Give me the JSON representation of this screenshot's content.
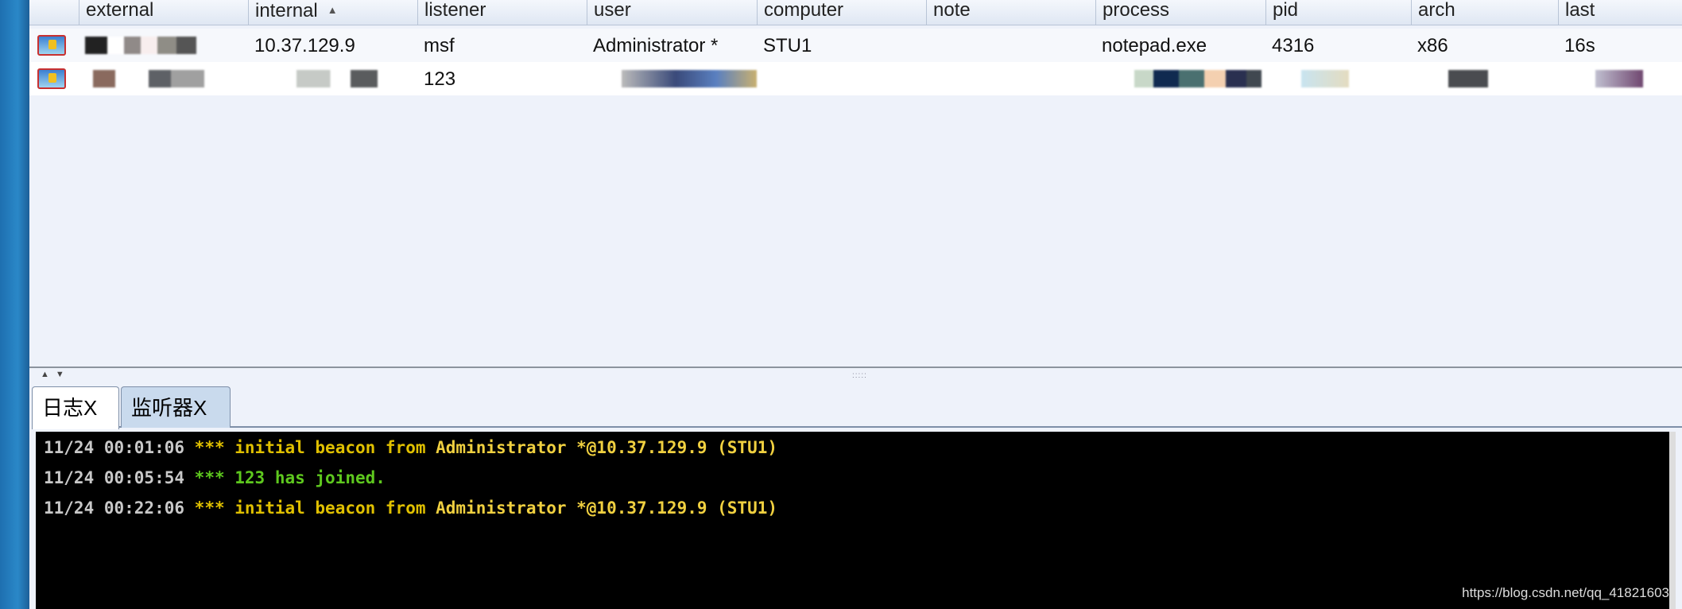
{
  "table": {
    "columns": [
      "external",
      "internal",
      "listener",
      "user",
      "computer",
      "note",
      "process",
      "pid",
      "arch",
      "last"
    ],
    "sorted_column": "internal",
    "rows": [
      {
        "external": "",
        "internal": "10.37.129.9",
        "listener": "msf",
        "user": "Administrator *",
        "computer": "STU1",
        "note": "",
        "process": "notepad.exe",
        "pid": "4316",
        "arch": "x86",
        "last": "16s",
        "icon": "windows-beacon-icon"
      },
      {
        "external": "",
        "internal": "",
        "listener": "123",
        "user": "",
        "computer": "",
        "note": "",
        "process": "",
        "pid": "",
        "arch": "",
        "last": "",
        "icon": "windows-beacon-icon"
      }
    ]
  },
  "tabs": [
    {
      "label": "日志X",
      "active": true
    },
    {
      "label": "监听器X",
      "active": false
    }
  ],
  "console": {
    "lines": [
      {
        "time": "11/24 00:01:06",
        "stars": "***",
        "msg": "initial beacon from",
        "who": "Administrator *@10.37.129.9 (STU1)"
      },
      {
        "time": "11/24 00:05:54",
        "stars": "***",
        "msg": "123 has joined.",
        "who": ""
      },
      {
        "time": "11/24 00:22:06",
        "stars": "***",
        "msg": "initial beacon from",
        "who": "Administrator *@10.37.129.9 (STU1)"
      }
    ],
    "watermark": "https://blog.csdn.net/qq_41821603"
  },
  "colors": {
    "console_bg": "#000000",
    "event": "#e0c000",
    "join": "#5ec81e",
    "accent": "#2a88c8"
  }
}
